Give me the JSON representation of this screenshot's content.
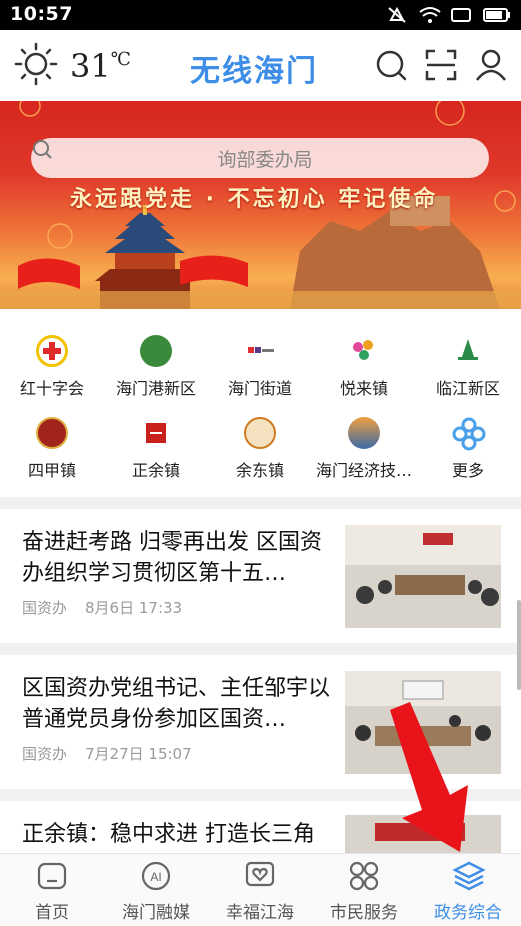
{
  "status_bar": {
    "time": "10:57"
  },
  "header": {
    "temperature": "31",
    "temperature_unit": "℃",
    "app_title": "无线海门"
  },
  "banner": {
    "search_placeholder": "询部委办局",
    "slogan": "永远跟党走 · 不忘初心 牢记使命"
  },
  "shortcuts": [
    {
      "label": "红十字会",
      "icon": "red-cross-icon",
      "color": "#e02a2a"
    },
    {
      "label": "海门港新区",
      "icon": "port-district-icon",
      "color": "#3b8a3b"
    },
    {
      "label": "海门街道",
      "icon": "street-office-icon",
      "color": "#5a3a8a"
    },
    {
      "label": "悦来镇",
      "icon": "yuelai-town-icon",
      "color": "#e0489a"
    },
    {
      "label": "临江新区",
      "icon": "linjiang-district-icon",
      "color": "#2a8a4a"
    },
    {
      "label": "四甲镇",
      "icon": "sijia-town-icon",
      "color": "#a0241c"
    },
    {
      "label": "正余镇",
      "icon": "zhengyu-town-icon",
      "color": "#c8201a"
    },
    {
      "label": "余东镇",
      "icon": "yudong-town-icon",
      "color": "#d07a20"
    },
    {
      "label": "海门经济技…",
      "icon": "economic-zone-icon",
      "color": "#3a6aa8"
    },
    {
      "label": "更多",
      "icon": "more-icon",
      "color": "#4aa0e8"
    }
  ],
  "news": [
    {
      "title": "奋进赶考路 归零再出发 区国资办组织学习贯彻区第十五…",
      "source": "国资办",
      "time": "8月6日 17:33"
    },
    {
      "title": "区国资办党组书记、主任邹宇以普通党员身份参加区国资…",
      "source": "国资办",
      "time": "7月27日 15:07"
    },
    {
      "title": "正余镇：稳中求进 打造长三角智能制造先导区",
      "source": "",
      "time": ""
    }
  ],
  "bottom_nav": [
    {
      "label": "首页",
      "icon": "home-icon"
    },
    {
      "label": "海门融媒",
      "icon": "ai-media-icon"
    },
    {
      "label": "幸福江海",
      "icon": "heart-frame-icon"
    },
    {
      "label": "市民服务",
      "icon": "four-circles-icon"
    },
    {
      "label": "政务综合",
      "icon": "layers-icon",
      "active": true
    }
  ],
  "colors": {
    "accent": "#3e8ee8",
    "banner_red": "#d6261e"
  }
}
